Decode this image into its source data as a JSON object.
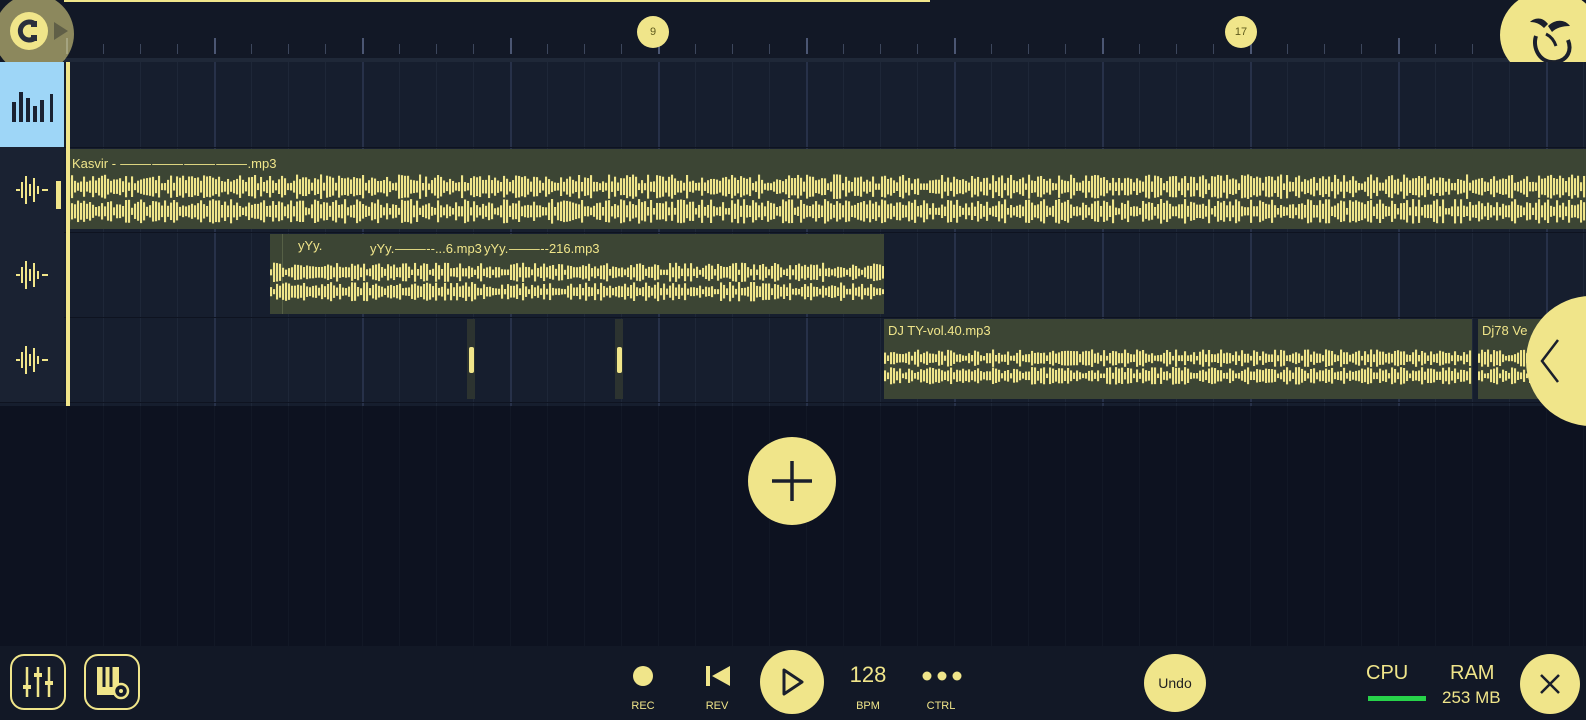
{
  "ruler": {
    "markers": [
      "9",
      "17"
    ]
  },
  "tracks": [
    {
      "clips": [
        {
          "label": "Kasvir - ⸻⸻⸻⸻.mp3"
        }
      ]
    },
    {
      "clips": [
        {
          "label": "yYy."
        },
        {
          "label": "yYy.⸻--...6.mp3"
        },
        {
          "label": "yYy.⸻--216.mp3"
        }
      ]
    },
    {
      "clips": [
        {
          "label": "DJ TY-vol.40.mp3"
        },
        {
          "label": "Dj78 Ve"
        }
      ]
    }
  ],
  "toolbar": {
    "rec_label": "REC",
    "rev_label": "REV",
    "bpm_value": "128",
    "bpm_label": "BPM",
    "ctrl_label": "CTRL",
    "undo_label": "Undo",
    "cpu_label": "CPU",
    "ram_label": "RAM",
    "ram_value": "253 MB"
  },
  "colors": {
    "accent": "#f0e58a",
    "background": "#0e1320",
    "track_active": "#9ed6f7",
    "cpu_meter": "#27d24a"
  },
  "icons": [
    "magnet-icon",
    "fruit-logo-icon",
    "mixer-icon",
    "wave-icon",
    "add-icon",
    "chevron-left-icon",
    "record-icon",
    "rewind-icon",
    "play-icon",
    "ellipsis-icon",
    "close-icon",
    "piano-gear-icon",
    "sliders-icon"
  ]
}
